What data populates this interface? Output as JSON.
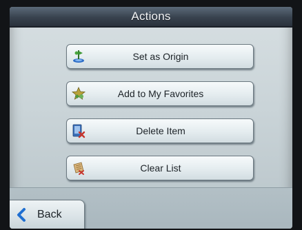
{
  "header": {
    "title": "Actions"
  },
  "actions": [
    {
      "label": "Set as Origin",
      "icon": "origin-pin-icon"
    },
    {
      "label": "Add to My Favorites",
      "icon": "favorites-star-icon"
    },
    {
      "label": "Delete Item",
      "icon": "delete-item-icon"
    },
    {
      "label": "Clear List",
      "icon": "clear-list-icon"
    }
  ],
  "footer": {
    "back_label": "Back",
    "back_icon": "chevron-left-icon"
  },
  "colors": {
    "titlebar": "#38424e",
    "screen": "#cad4d8",
    "button": "#e4ecef",
    "back_chevron": "#1f6fd1"
  }
}
